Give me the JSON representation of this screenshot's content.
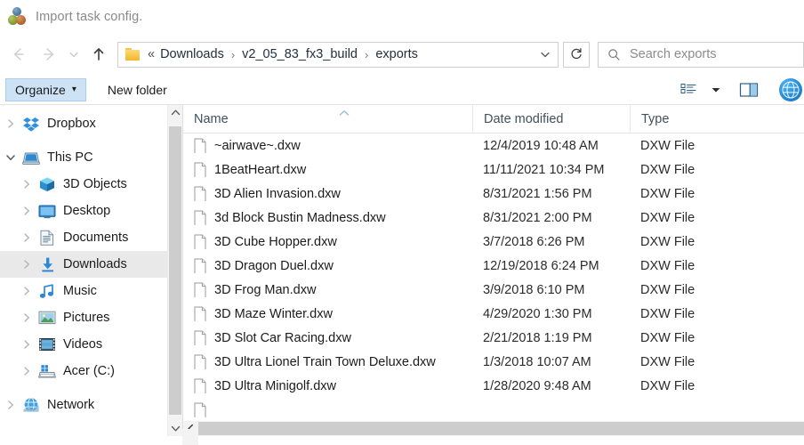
{
  "window": {
    "title": "Import task config.",
    "icon": "three-circles-icon"
  },
  "navigation": {
    "back_icon": "arrow-left-icon",
    "forward_icon": "arrow-right-icon",
    "recent_icon": "chevron-down-icon",
    "up_icon": "arrow-up-icon"
  },
  "address_bar": {
    "folder_icon": "folder-icon",
    "overflow": "«",
    "crumbs": [
      "Downloads",
      "v2_05_83_fx3_build",
      "exports"
    ],
    "separator": "›",
    "dropdown_icon": "chevron-down-icon",
    "refresh_icon": "refresh-icon"
  },
  "search": {
    "icon": "search-icon",
    "placeholder": "Search exports"
  },
  "command_bar": {
    "organize_label": "Organize",
    "organize_caret": "▾",
    "new_folder_label": "New folder",
    "view_icon": "view-list-icon",
    "view_caret_icon": "chevron-down-icon",
    "preview_pane_icon": "preview-pane-icon",
    "help_icon": "help-globe-icon"
  },
  "sidebar": {
    "items": [
      {
        "label": "Dropbox",
        "icon": "dropbox-icon",
        "indent": 0,
        "chevron": "collapsed",
        "selected": false
      },
      {
        "label": "This PC",
        "icon": "this-pc-icon",
        "indent": 0,
        "chevron": "expanded",
        "selected": false
      },
      {
        "label": "3D Objects",
        "icon": "3d-objects-icon",
        "indent": 1,
        "chevron": "collapsed",
        "selected": false
      },
      {
        "label": "Desktop",
        "icon": "desktop-icon",
        "indent": 1,
        "chevron": "collapsed",
        "selected": false
      },
      {
        "label": "Documents",
        "icon": "documents-icon",
        "indent": 1,
        "chevron": "collapsed",
        "selected": false
      },
      {
        "label": "Downloads",
        "icon": "downloads-icon",
        "indent": 1,
        "chevron": "collapsed",
        "selected": true
      },
      {
        "label": "Music",
        "icon": "music-icon",
        "indent": 1,
        "chevron": "collapsed",
        "selected": false
      },
      {
        "label": "Pictures",
        "icon": "pictures-icon",
        "indent": 1,
        "chevron": "collapsed",
        "selected": false
      },
      {
        "label": "Videos",
        "icon": "videos-icon",
        "indent": 1,
        "chevron": "collapsed",
        "selected": false
      },
      {
        "label": "Acer (C:)",
        "icon": "drive-icon",
        "indent": 1,
        "chevron": "collapsed",
        "selected": false
      },
      {
        "label": "Network",
        "icon": "network-icon",
        "indent": 0,
        "chevron": "collapsed",
        "selected": false
      }
    ]
  },
  "file_list": {
    "columns": [
      "Name",
      "Date modified",
      "Type"
    ],
    "sort_column": "Name",
    "sort_direction": "ascending",
    "rows": [
      {
        "name": "~airwave~.dxw",
        "date": "12/4/2019 10:48 AM",
        "type": "DXW File"
      },
      {
        "name": "1BeatHeart.dxw",
        "date": "11/11/2021 10:34 PM",
        "type": "DXW File"
      },
      {
        "name": "3D Alien Invasion.dxw",
        "date": "8/31/2021 1:56 PM",
        "type": "DXW File"
      },
      {
        "name": "3d Block Bustin Madness.dxw",
        "date": "8/31/2021 2:00 PM",
        "type": "DXW File"
      },
      {
        "name": "3D Cube Hopper.dxw",
        "date": "3/7/2018 6:26 PM",
        "type": "DXW File"
      },
      {
        "name": "3D Dragon Duel.dxw",
        "date": "12/19/2018 6:24 PM",
        "type": "DXW File"
      },
      {
        "name": "3D Frog Man.dxw",
        "date": "3/9/2018 6:10 PM",
        "type": "DXW File"
      },
      {
        "name": "3D Maze Winter.dxw",
        "date": "4/29/2020 1:30 PM",
        "type": "DXW File"
      },
      {
        "name": "3D Slot Car Racing.dxw",
        "date": "2/21/2018 1:19 PM",
        "type": "DXW File"
      },
      {
        "name": "3D Ultra Lionel Train Town Deluxe.dxw",
        "date": "1/3/2018 10:07 AM",
        "type": "DXW File"
      },
      {
        "name": "3D Ultra Minigolf.dxw",
        "date": "1/28/2020 9:48 AM",
        "type": "DXW File"
      }
    ]
  },
  "colors": {
    "accent": "#0f6cbd",
    "selection": "#cde2f4",
    "row_highlight": "#e9e9e9",
    "scrollbar_thumb": "#cdcdcd",
    "folder_yellow": "#f2b529"
  }
}
